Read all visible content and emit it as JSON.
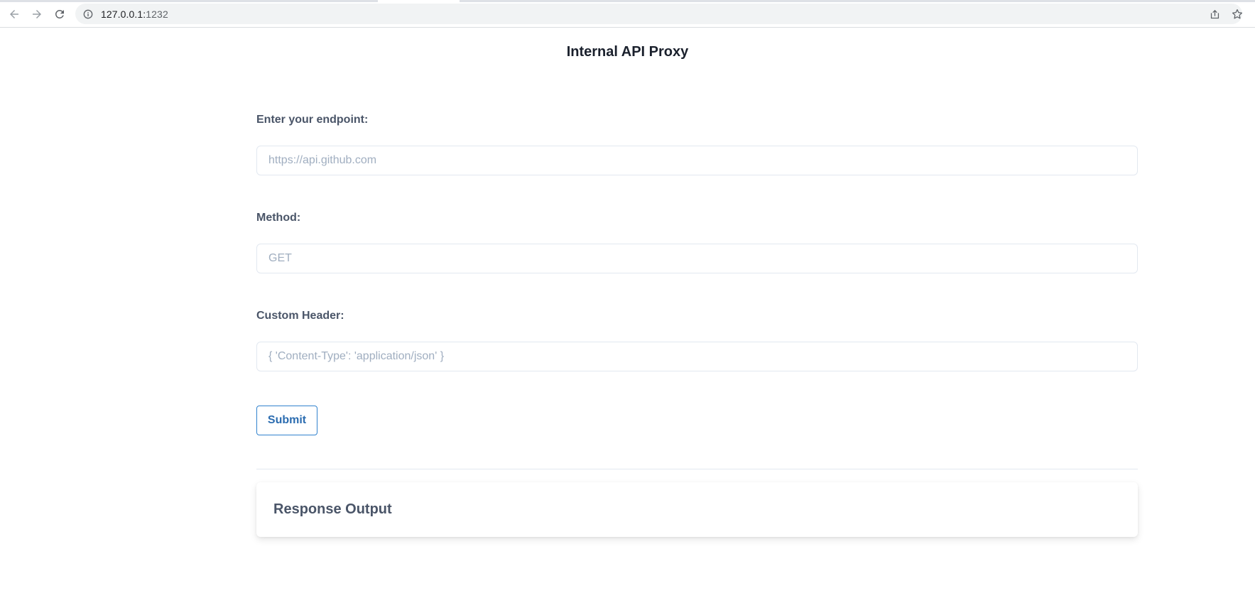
{
  "browser": {
    "url_host": "127.0.0.1:",
    "url_port": "1232",
    "icons": {
      "back": "back-arrow-icon",
      "forward": "forward-arrow-icon",
      "reload": "reload-icon",
      "info": "info-icon",
      "share": "share-icon",
      "bookmark": "star-icon"
    }
  },
  "page": {
    "title": "Internal API Proxy"
  },
  "form": {
    "endpoint": {
      "label": "Enter your endpoint:",
      "placeholder": "https://api.github.com",
      "value": ""
    },
    "method": {
      "label": "Method:",
      "placeholder": "GET",
      "value": ""
    },
    "custom_header": {
      "label": "Custom Header:",
      "placeholder": "{ 'Content-Type': 'application/json' }",
      "value": ""
    },
    "submit_label": "Submit"
  },
  "response": {
    "title": "Response Output"
  },
  "colors": {
    "accent": "#3182ce",
    "button_text": "#2b6cb0",
    "label": "#4a5568",
    "placeholder": "#a0aec0",
    "border": "#e2e8f0"
  }
}
